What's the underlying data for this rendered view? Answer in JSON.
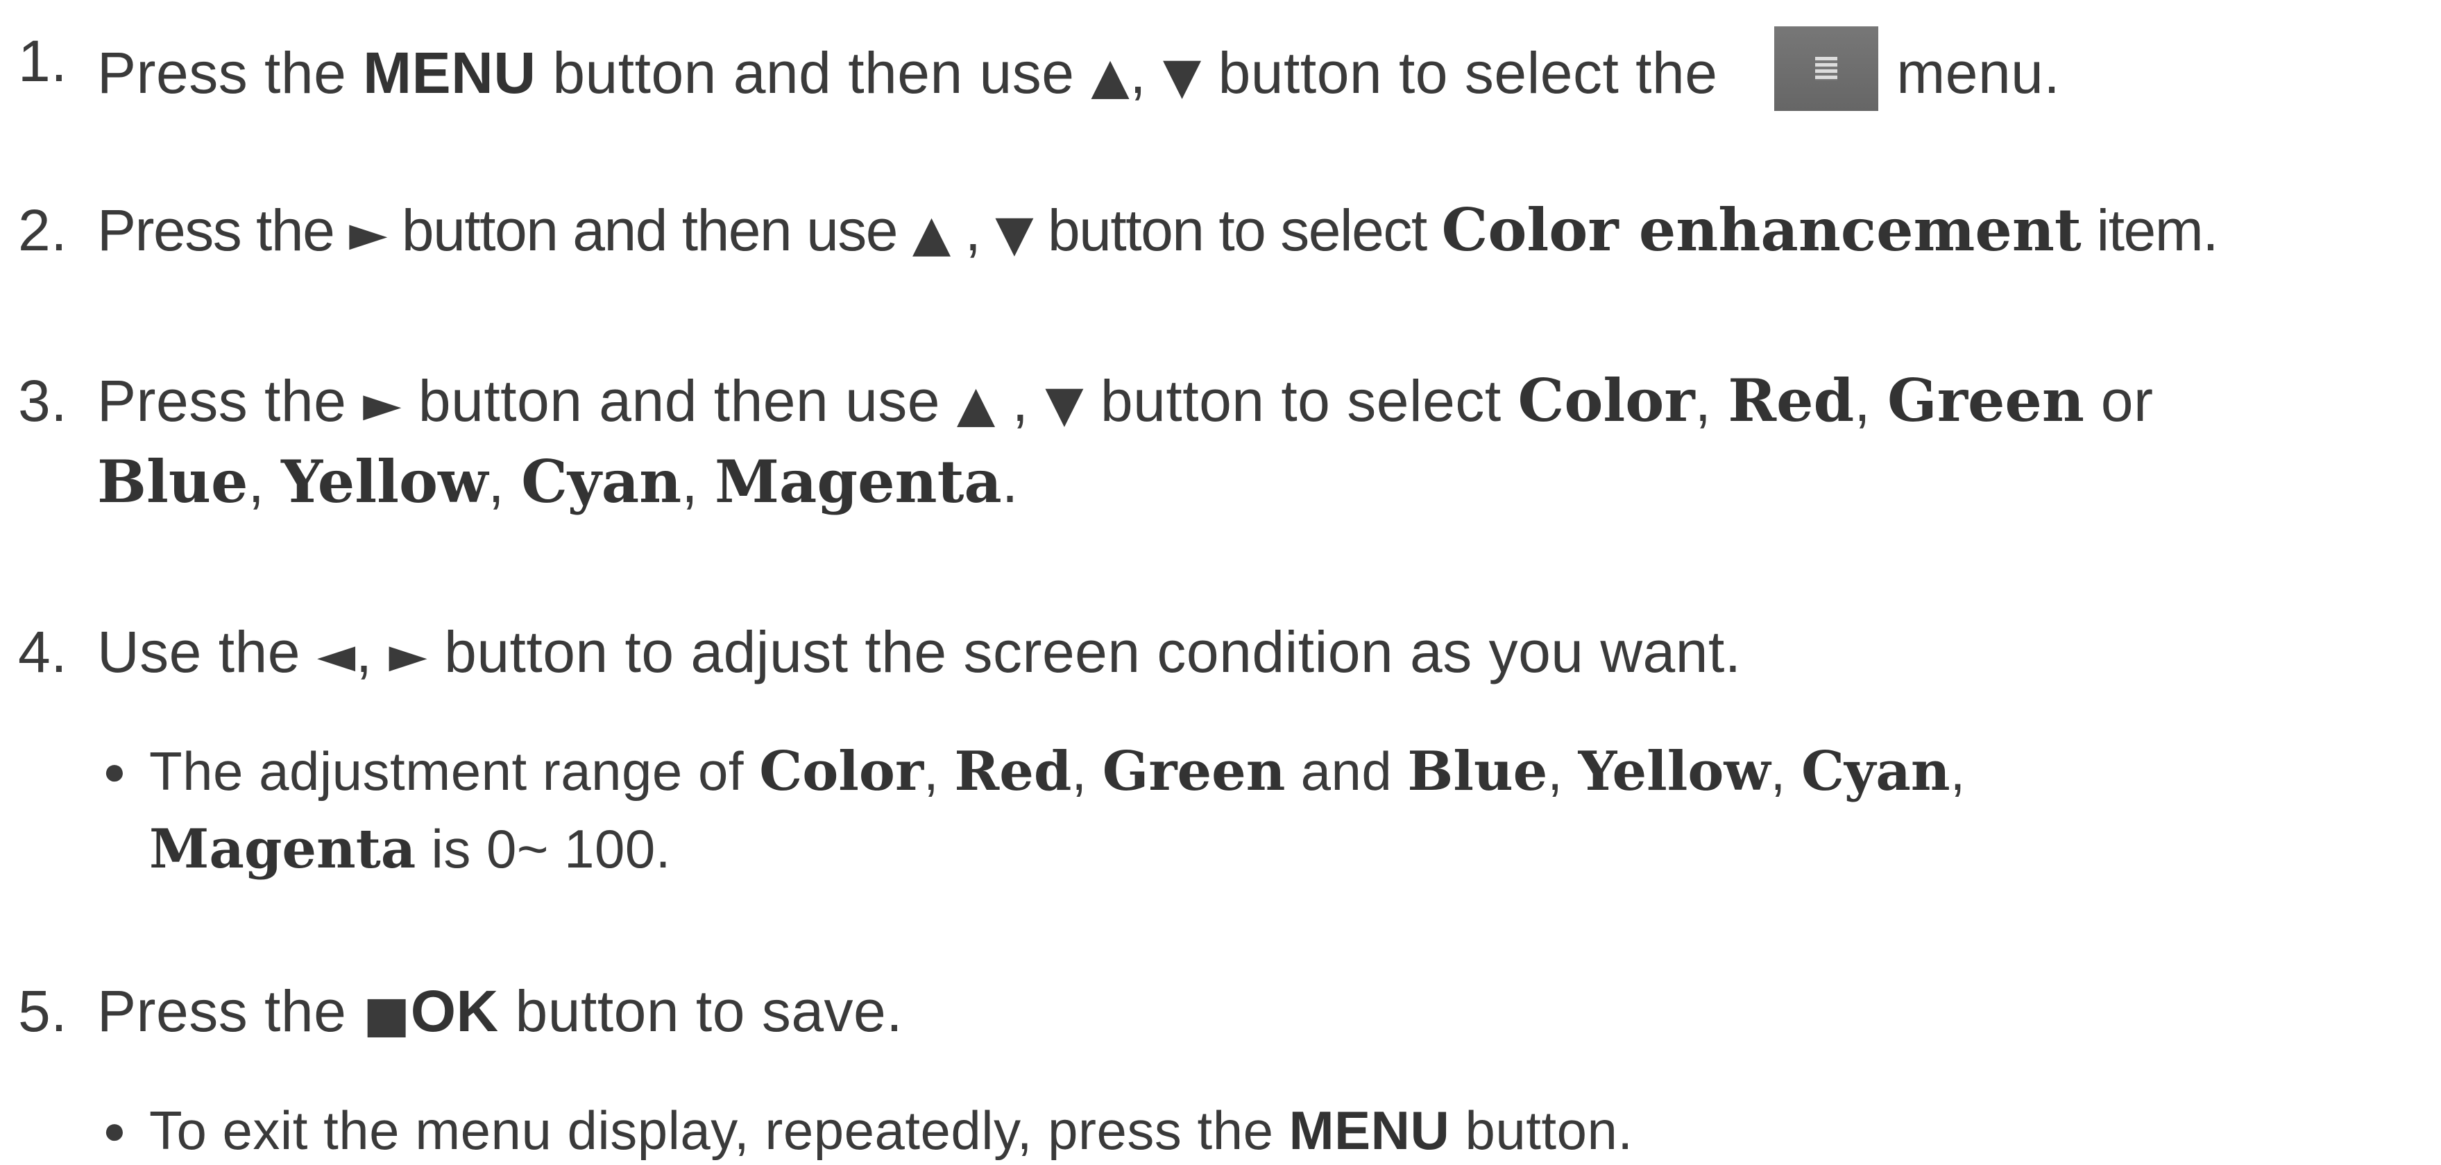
{
  "steps": [
    {
      "number": "1.",
      "parts": {
        "a": "Press the ",
        "b": "MENU",
        "c": " button and then use ",
        "up": "▲",
        "comma": ", ",
        "down": "▼",
        "d": " button to select the ",
        "icon": "menu-icon",
        "e": "menu."
      }
    },
    {
      "number": "2.",
      "parts": {
        "a": "Press the ",
        "right": "►",
        "b": " button and then use ",
        "up": "▲",
        "comma": " , ",
        "down": "▼",
        "c": " button to select ",
        "bold": "Color enhancement",
        "d": " item."
      }
    },
    {
      "number": "3.",
      "parts": {
        "a": "Press the ",
        "right": "►",
        "b": " button and then use ",
        "up": "▲",
        "comma": " , ",
        "down": "▼",
        "c": " button to select ",
        "color": "Color",
        "sep1": ", ",
        "red": "Red",
        "sep2": ", ",
        "green": "Green",
        "or": " or",
        "blue": "Blue",
        "sep3": ", ",
        "yellow": "Yellow",
        "sep4": ", ",
        "cyan": "Cyan",
        "sep5": ", ",
        "magenta": "Magenta",
        "end": "."
      }
    },
    {
      "number": "4.",
      "parts": {
        "a": "Use the ",
        "left": "◄",
        "comma": ", ",
        "right": "►",
        "b": " button to adjust the screen condition as you want."
      },
      "bullet": {
        "mark": "●",
        "a": "The adjustment range of ",
        "color": "Color",
        "sep1": ", ",
        "red": "Red",
        "sep2": ", ",
        "green": "Green",
        "and": " and ",
        "blue": "Blue",
        "sep3": ", ",
        "yellow": "Yellow",
        "sep4": ", ",
        "cyan": "Cyan",
        "sep5": ",",
        "magenta": "Magenta",
        "range": " is 0~ 100."
      }
    },
    {
      "number": "5.",
      "parts": {
        "a": "Press the ",
        "square": "■",
        "ok": "OK",
        "b": " button to save."
      },
      "bullet": {
        "mark": "●",
        "a": "To exit the menu display, repeatedly, press the ",
        "menu": "MENU",
        "b": " button."
      }
    }
  ]
}
